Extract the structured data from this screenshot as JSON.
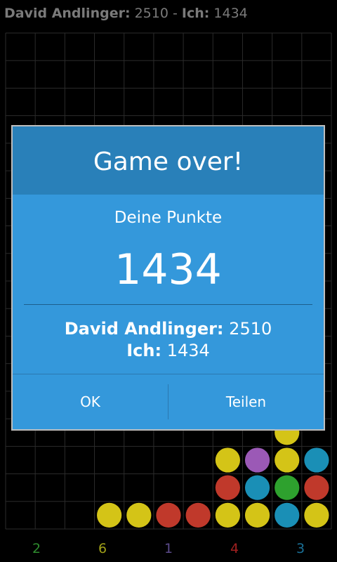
{
  "header": {
    "p1_name": "David Andlinger:",
    "p1_score": "2510",
    "sep": "-",
    "p2_name": "Ich:",
    "p2_score": "1434"
  },
  "board": {
    "rows": 18,
    "cols": 11,
    "balls": [
      [
        "yellow",
        "yellow",
        "red",
        "red",
        "yellow",
        "yellow",
        "blue",
        "yellow"
      ],
      [
        "",
        "red",
        "blue",
        "green",
        "red"
      ],
      [
        "",
        "yellow",
        "purple",
        "yellow",
        "blue"
      ]
    ],
    "colors": {
      "red": "#c0392b",
      "yellow": "#d4c417",
      "blue": "#1a8fb6",
      "green": "#2ea12e",
      "purple": "#9b59b6",
      "grid": "#2b2b2b"
    }
  },
  "counts": [
    {
      "value": "2",
      "color": "#2e8b2e"
    },
    {
      "value": "6",
      "color": "#a0a018"
    },
    {
      "value": "1",
      "color": "#5a4a8a"
    },
    {
      "value": "4",
      "color": "#a02020"
    },
    {
      "value": "3",
      "color": "#1a6f96"
    }
  ],
  "dialog": {
    "title": "Game over!",
    "score_label": "Deine Punkte",
    "score_value": "1434",
    "p1_name": "David Andlinger:",
    "p1_score": "2510",
    "p2_name": "Ich:",
    "p2_score": "1434",
    "ok_label": "OK",
    "share_label": "Teilen"
  }
}
